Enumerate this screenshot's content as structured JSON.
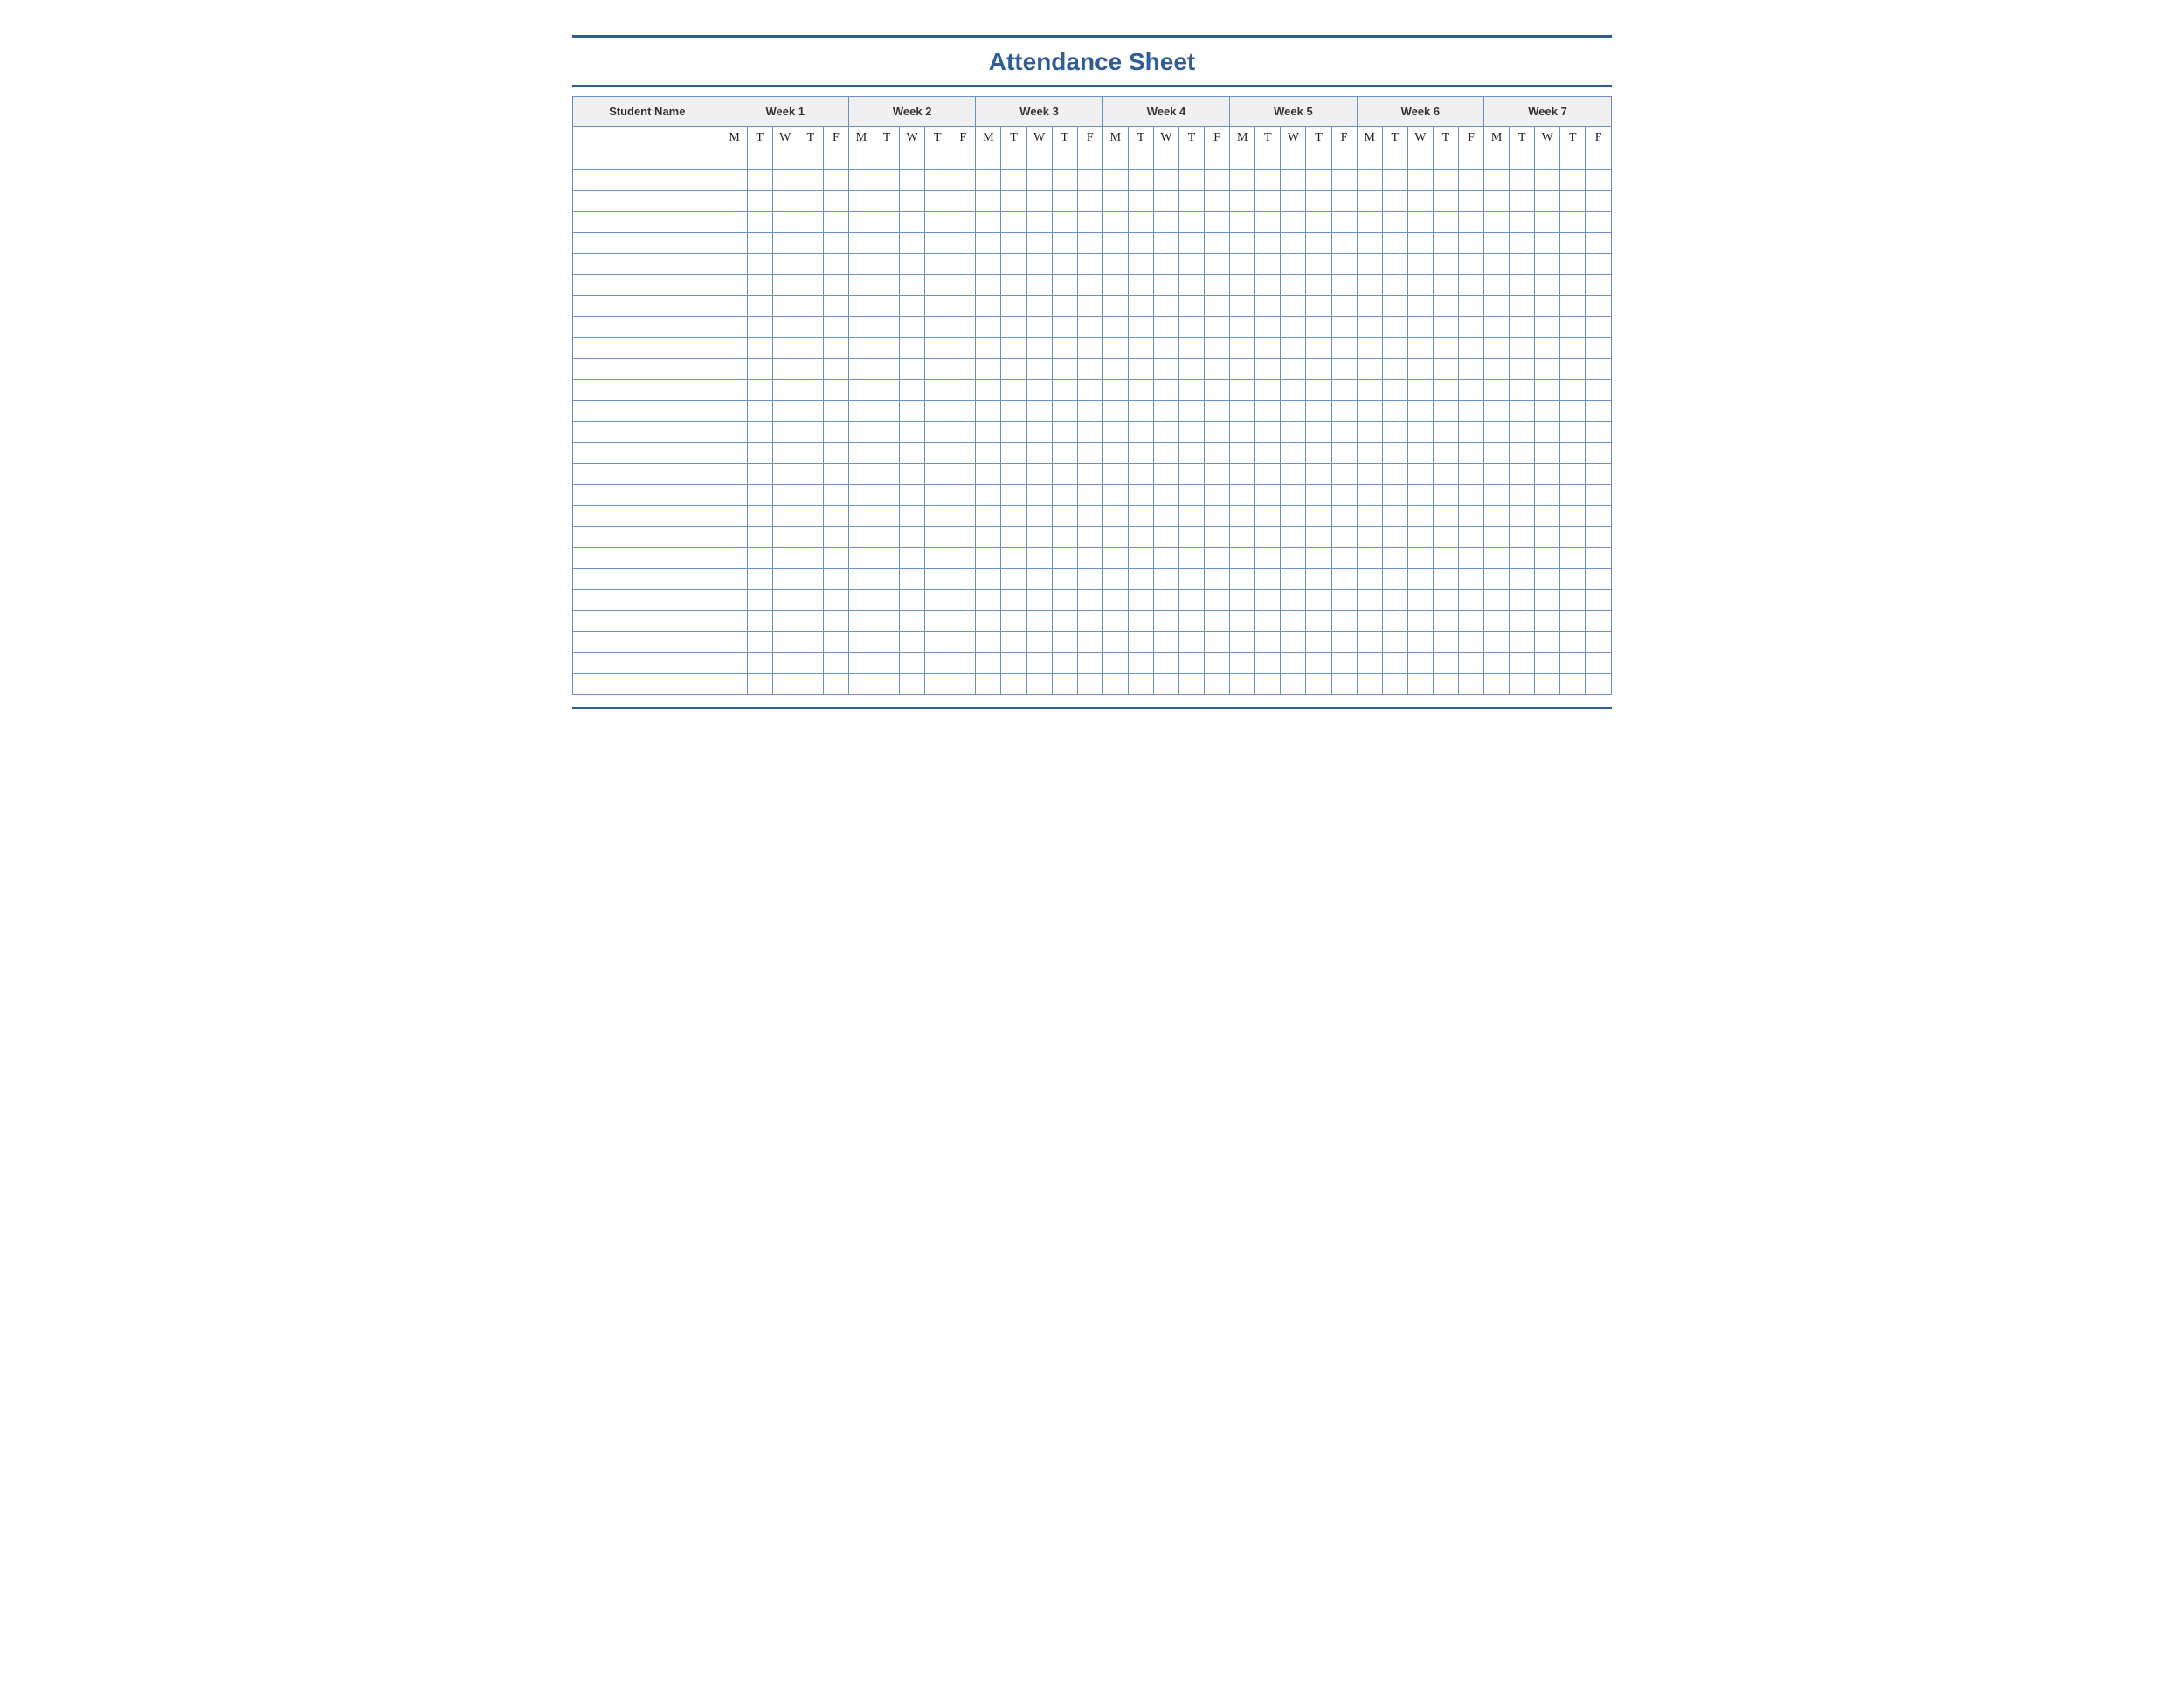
{
  "title": "Attendance Sheet",
  "headers": {
    "name": "Student Name",
    "weeks": [
      "Week 1",
      "Week 2",
      "Week 3",
      "Week 4",
      "Week 5",
      "Week 6",
      "Week 7"
    ]
  },
  "days": [
    "M",
    "T",
    "W",
    "T",
    "F"
  ],
  "rows": 26,
  "colors": {
    "accent": "#2f5c9b",
    "grid": "#6a8fc7",
    "headerBg": "#f0f0f0"
  }
}
